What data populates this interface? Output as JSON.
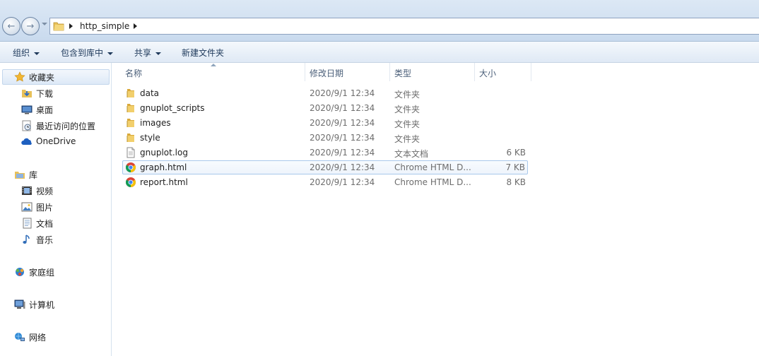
{
  "address": {
    "path": [
      "http_simple"
    ]
  },
  "toolbar": {
    "organize": "组织",
    "include_in_library": "包含到库中",
    "share": "共享",
    "new_folder": "新建文件夹"
  },
  "nav": {
    "favorites": "收藏夹",
    "downloads": "下载",
    "desktop": "桌面",
    "recent": "最近访问的位置",
    "onedrive": "OneDrive",
    "libraries": "库",
    "videos": "视频",
    "pictures": "图片",
    "documents": "文档",
    "music": "音乐",
    "homegroup": "家庭组",
    "computer": "计算机",
    "network": "网络"
  },
  "columns": {
    "name": "名称",
    "date": "修改日期",
    "type": "类型",
    "size": "大小"
  },
  "files": [
    {
      "name": "data",
      "date": "2020/9/1 12:34",
      "type": "文件夹",
      "size": "",
      "icon": "folder-icon"
    },
    {
      "name": "gnuplot_scripts",
      "date": "2020/9/1 12:34",
      "type": "文件夹",
      "size": "",
      "icon": "folder-icon"
    },
    {
      "name": "images",
      "date": "2020/9/1 12:34",
      "type": "文件夹",
      "size": "",
      "icon": "folder-icon"
    },
    {
      "name": "style",
      "date": "2020/9/1 12:34",
      "type": "文件夹",
      "size": "",
      "icon": "folder-icon"
    },
    {
      "name": "gnuplot.log",
      "date": "2020/9/1 12:34",
      "type": "文本文档",
      "size": "6 KB",
      "icon": "text-file-icon"
    },
    {
      "name": "graph.html",
      "date": "2020/9/1 12:34",
      "type": "Chrome HTML D...",
      "size": "7 KB",
      "icon": "chrome-icon",
      "selected": true
    },
    {
      "name": "report.html",
      "date": "2020/9/1 12:34",
      "type": "Chrome HTML D...",
      "size": "8 KB",
      "icon": "chrome-icon"
    }
  ],
  "colors": {
    "selection_border": "#a8c8eb",
    "folder": "#e8c15a",
    "onedrive": "#1e5fbf"
  }
}
